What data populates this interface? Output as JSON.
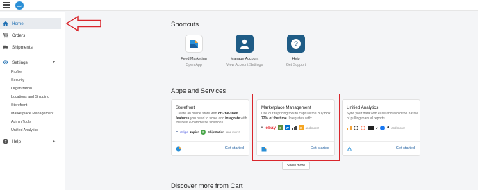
{
  "header": {
    "logo_text": "cart",
    "menu_icon": "hamburger-icon"
  },
  "sidebar": {
    "items": [
      {
        "label": "Home",
        "icon": "home-icon",
        "active": true
      },
      {
        "label": "Orders",
        "icon": "cart-icon"
      },
      {
        "label": "Shipments",
        "icon": "truck-icon"
      },
      {
        "label": "Settings",
        "icon": "gear-icon",
        "expanded": true
      },
      {
        "label": "Help",
        "icon": "help-circle-icon"
      }
    ],
    "settings_subitems": [
      "Profile",
      "Security",
      "Organization",
      "Locations and Shipping",
      "Storefront",
      "Marketplace Management",
      "Admin Tools",
      "Unified Analytics"
    ]
  },
  "shortcuts": {
    "title": "Shortcuts",
    "items": [
      {
        "title": "Feed Marketing",
        "subtitle": "Open App",
        "icon": "feed-marketing-icon"
      },
      {
        "title": "Manage Account",
        "subtitle": "View Account Settings",
        "icon": "user-icon"
      },
      {
        "title": "Help",
        "subtitle": "Get Support",
        "icon": "question-icon"
      }
    ]
  },
  "apps": {
    "title": "Apps and Services",
    "cards": [
      {
        "title": "Storefront",
        "desc_parts": [
          "Create an online store with ",
          "off-the-shelf features",
          " you need to scale and ",
          "integrate",
          " with the best e-commerce solutions."
        ],
        "logos": [
          "P",
          "stripe",
          "zapier",
          "S",
          "ShipStation"
        ],
        "and_more": "and more!",
        "cta": "Get started"
      },
      {
        "title": "Marketplace Management",
        "desc_parts": [
          "Use our repricing tool to capture the Buy Box ",
          "72% of the time",
          ". Integrates with:"
        ],
        "logos": [
          "a",
          "ebay",
          "S",
          "W",
          "K"
        ],
        "and_more": "and more!",
        "cta": "Get started"
      },
      {
        "title": "Unified Analytics",
        "desc_parts": [
          "Sync your data with ease and avoid the hassle of pulling manual reports."
        ],
        "logos": [
          "a"
        ],
        "and_more": "and more!",
        "cta": "Get started"
      }
    ],
    "show_more": "Show more"
  },
  "discover": {
    "title": "Discover more from Cart"
  },
  "colors": {
    "accent": "#1f6fb2",
    "highlight": "#d9262c",
    "brand": "#2a8fd6"
  }
}
